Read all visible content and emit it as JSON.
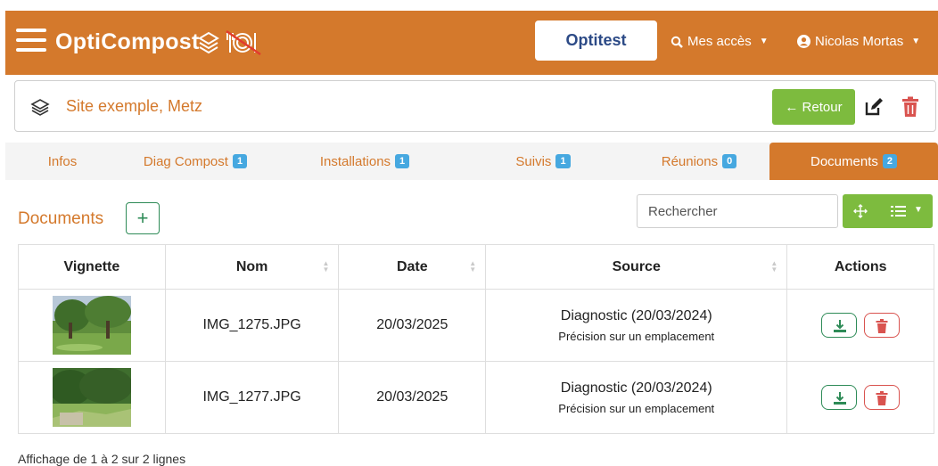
{
  "navbar": {
    "brand": "OptiCompost",
    "environment": "Optitest",
    "access_menu": "Mes accès",
    "user_menu": "Nicolas Mortas"
  },
  "header": {
    "site_title": "Site exemple, Metz",
    "back_button": "← Retour"
  },
  "tabs": [
    {
      "label": "Infos",
      "badge": ""
    },
    {
      "label": "Diag Compost",
      "badge": "1"
    },
    {
      "label": "Installations",
      "badge": "1"
    },
    {
      "label": "Suivis",
      "badge": "1"
    },
    {
      "label": "Réunions",
      "badge": "0"
    },
    {
      "label": "Documents",
      "badge": "2"
    }
  ],
  "documents": {
    "title": "Documents",
    "add_label": "+",
    "search_placeholder": "Rechercher",
    "columns": [
      "Vignette",
      "Nom",
      "Date",
      "Source",
      "Actions"
    ],
    "rows": [
      {
        "name": "IMG_1275.JPG",
        "date": "20/03/2025",
        "source": "Diagnostic (20/03/2024)",
        "source_detail": "Précision sur un emplacement"
      },
      {
        "name": "IMG_1277.JPG",
        "date": "20/03/2025",
        "source": "Diagnostic (20/03/2024)",
        "source_detail": "Précision sur un emplacement"
      }
    ],
    "footer": "Affichage de 1 à 2 sur 2 lignes"
  },
  "colors": {
    "brand": "#d4792c",
    "success": "#7dbb3e",
    "badge": "#46a8e0",
    "danger": "#d9534f"
  }
}
